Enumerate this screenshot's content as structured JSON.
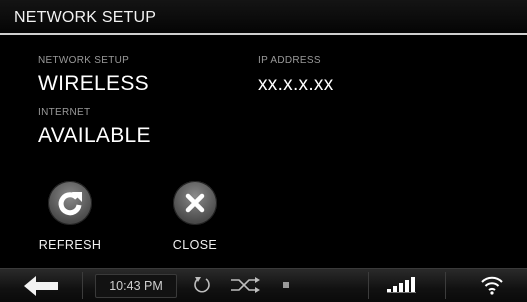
{
  "header": {
    "title": "NETWORK SETUP"
  },
  "info": {
    "network_setup_label": "NETWORK SETUP",
    "network_setup_value": "WIRELESS",
    "internet_label": "INTERNET",
    "internet_value": "AVAILABLE",
    "ip_address_label": "IP ADDRESS",
    "ip_address_value": "xx.x.x.xx"
  },
  "actions": {
    "refresh_label": "REFRESH",
    "close_label": "CLOSE"
  },
  "taskbar": {
    "time": "10:43 PM",
    "icons": [
      "back-arrow-icon",
      "rotate-icon",
      "shuffle-icon",
      "stop-icon",
      "signal-bars-icon",
      "wifi-icon"
    ]
  },
  "colors": {
    "background": "#000000",
    "label_gray": "#9a9a9a",
    "button_gray": "#666666"
  }
}
